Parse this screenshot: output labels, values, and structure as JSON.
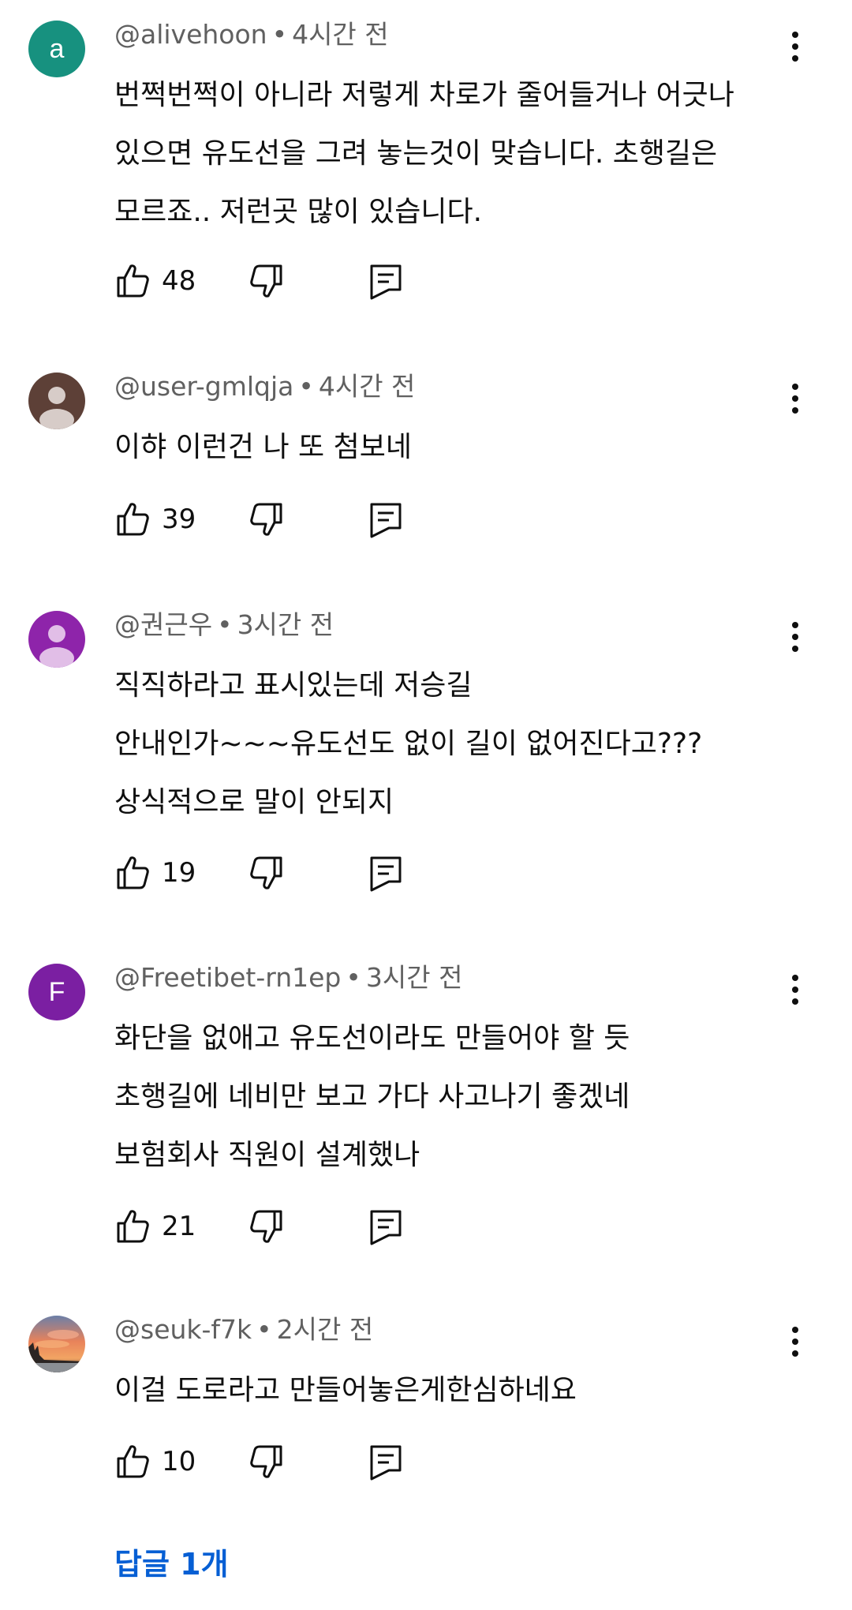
{
  "comments": [
    {
      "author": "@alivehoon",
      "time": "4시간 전",
      "lines": [
        "번쩍번쩍이 아니라 저렇게 차로가 줄어들거나 어긋나",
        "있으면 유도선을 그려 놓는것이 맞습니다. 초행길은",
        "모르죠.. 저런곳 많이 있습니다."
      ],
      "likes": "48",
      "avatar": {
        "type": "letter",
        "letter": "a",
        "color": "#17917f"
      }
    },
    {
      "author": "@user-gmlqja",
      "time": "4시간 전",
      "lines": [
        "이햐 이런건 나 또 첨보네"
      ],
      "likes": "39",
      "avatar": {
        "type": "default",
        "color": "#5d4037",
        "figure_color": "#d7ccc8"
      }
    },
    {
      "author": "@권근우",
      "time": "3시간 전",
      "lines": [
        "직직하라고 표시있는데 저승길",
        "안내인가~~~유도선도 없이 길이 없어진다고???",
        "상식적으로 말이 안되지"
      ],
      "likes": "19",
      "avatar": {
        "type": "default",
        "color": "#8e24aa",
        "figure_color": "#e1bee7"
      }
    },
    {
      "author": "@Freetibet-rn1ep",
      "time": "3시간 전",
      "lines": [
        "화단을 없애고 유도선이라도 만들어야 할 듯",
        "초행길에 네비만 보고 가다 사고나기 좋겠네",
        "보험회사 직원이 설계했나"
      ],
      "likes": "21",
      "avatar": {
        "type": "letter",
        "letter": "F",
        "color": "#7b1fa2"
      }
    },
    {
      "author": "@seuk-f7k",
      "time": "2시간 전",
      "lines": [
        "이걸 도로라고 만들어놓은게한심하네요"
      ],
      "likes": "10",
      "avatar": {
        "type": "photo"
      }
    }
  ],
  "replies_link": "답글 1개",
  "separator": "•",
  "icons": {
    "like": "thumbs-up-icon",
    "dislike": "thumbs-down-icon",
    "reply": "reply-icon",
    "more": "more-vert-icon"
  },
  "colors": {
    "link": "#065fd4",
    "meta": "#606060",
    "text": "#0f0f0f"
  }
}
